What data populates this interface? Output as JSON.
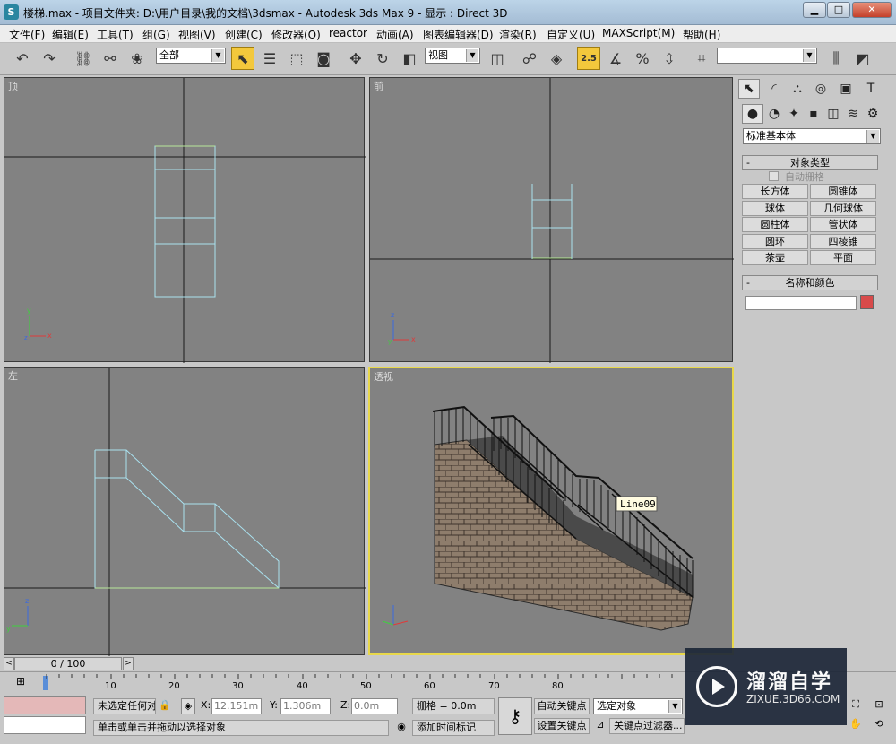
{
  "window": {
    "title": "楼梯.max    - 项目文件夹: D:\\用户目录\\我的文档\\3dsmax    - Autodesk 3ds Max 9    - 显示 : Direct 3D",
    "app_icon": "S"
  },
  "menu": [
    "文件(F)",
    "编辑(E)",
    "工具(T)",
    "组(G)",
    "视图(V)",
    "创建(C)",
    "修改器(O)",
    "reactor",
    "动画(A)",
    "图表编辑器(D)",
    "渲染(R)",
    "自定义(U)",
    "MAXScript(M)",
    "帮助(H)"
  ],
  "toolbar": {
    "selection_filter": "全部",
    "ref_coord": "视图",
    "snap_value": "2.5",
    "named_selection": ""
  },
  "viewports": {
    "top": "顶",
    "front": "前",
    "left": "左",
    "perspective": "透视",
    "tooltip": "Line09"
  },
  "command_panel": {
    "category": "标准基本体",
    "object_type_title": "对象类型",
    "auto_grid": "自动栅格",
    "buttons": [
      "长方体",
      "圆锥体",
      "球体",
      "几何球体",
      "圆柱体",
      "管状体",
      "圆环",
      "四棱锥",
      "茶壶",
      "平面"
    ],
    "name_color_title": "名称和颜色",
    "name_value": "",
    "swatch_color": "#d84a4a"
  },
  "timeline": {
    "frame": "0 / 100",
    "ticks": [
      "10",
      "20",
      "30",
      "40",
      "50",
      "60",
      "70",
      "80"
    ]
  },
  "status": {
    "selection": "未选定任何对",
    "prompt": "单击或单击并拖动以选择对象",
    "x_label": "X:",
    "x_value": "12.151m",
    "y_label": "Y:",
    "y_value": "1.306m",
    "z_label": "Z:",
    "z_value": "0.0m",
    "grid": "栅格 = 0.0m",
    "add_time_tag": "添加时间标记",
    "auto_key": "自动关键点",
    "set_key": "设置关键点",
    "selected_object": "选定对象",
    "key_filters": "关键点过滤器...",
    "swatch_top": "#e4b8b8"
  },
  "watermark": {
    "name": "溜溜自学",
    "url": "ZIXUE.3D66.COM"
  }
}
